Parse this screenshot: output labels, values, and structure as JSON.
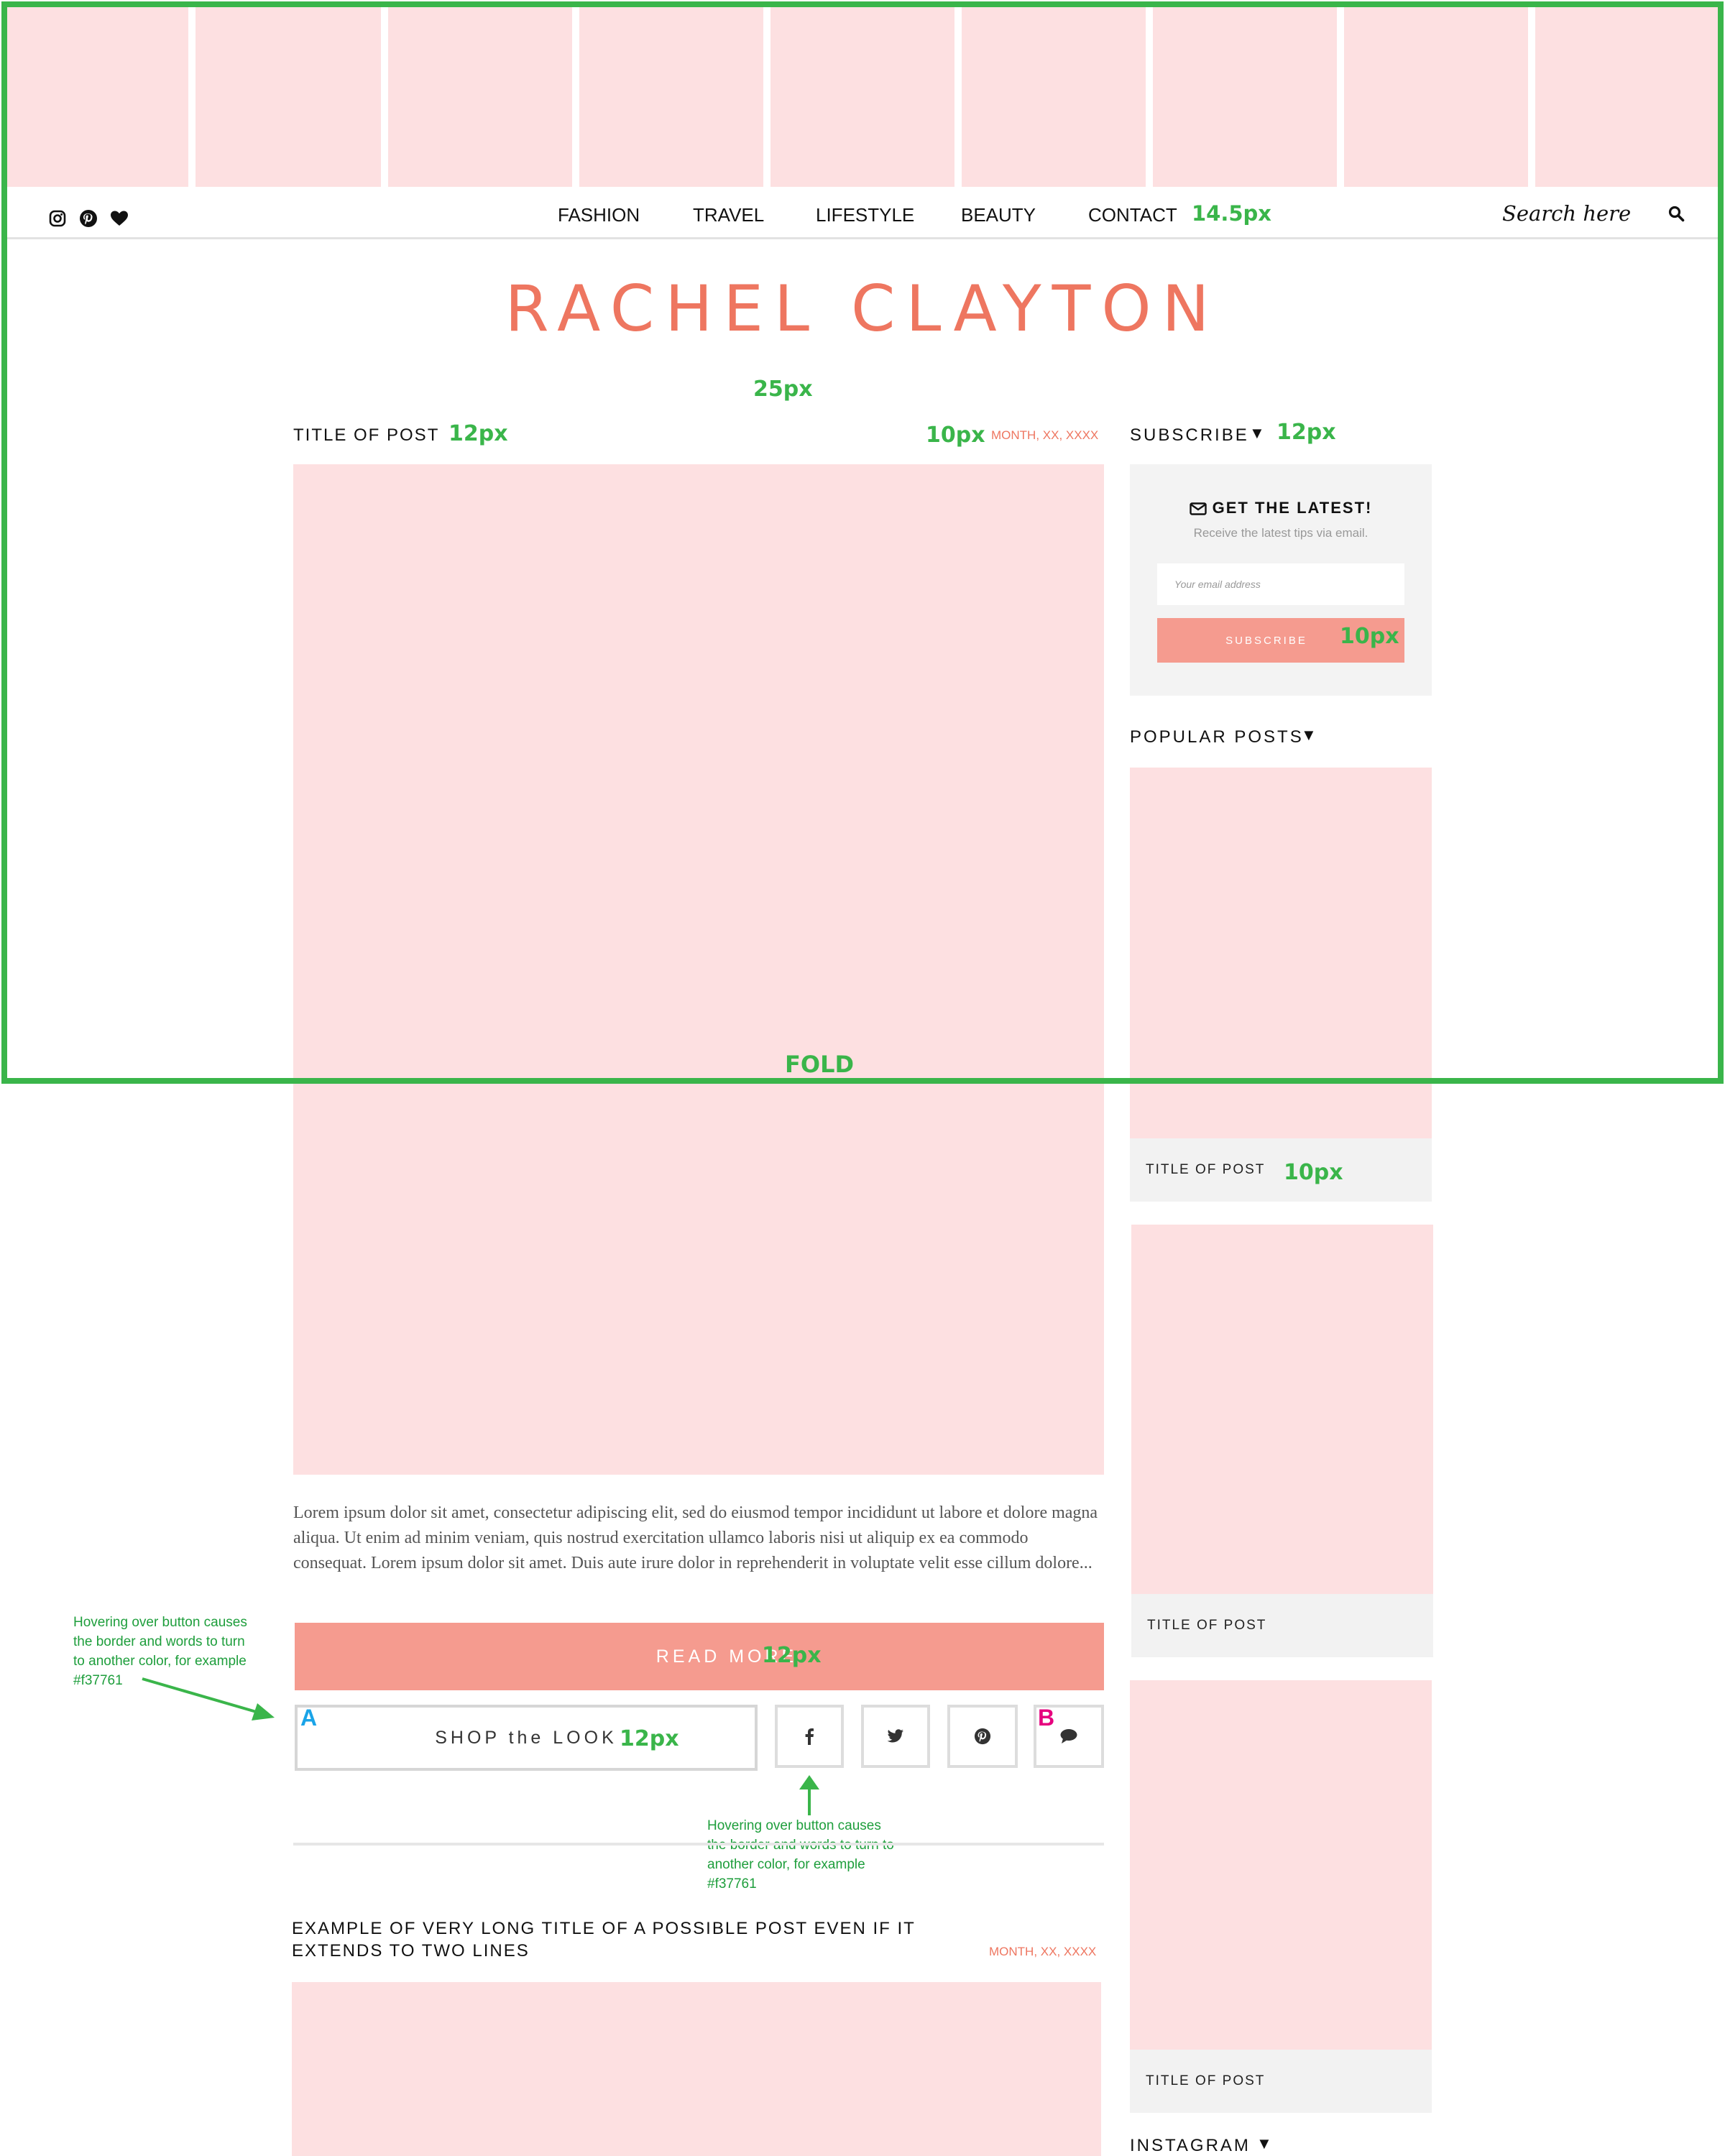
{
  "nav": {
    "items": [
      "FASHION",
      "TRAVEL",
      "LIFESTYLE",
      "BEAUTY",
      "CONTACT"
    ],
    "search_placeholder": "Search here",
    "social_icons": [
      "instagram-icon",
      "pinterest-icon",
      "heart-icon"
    ]
  },
  "site": {
    "title": "RACHEL CLAYTON",
    "accent_color": "#ee7660",
    "tile_color": "#fde0e1",
    "annotation_color": "#3ab54a"
  },
  "post1": {
    "title": "TITLE OF POST",
    "date": "MONTH, XX, XXXX",
    "excerpt": "Lorem ipsum dolor sit amet, consectetur adipiscing elit, sed do eiusmod tempor incididunt ut labore et dolore magna aliqua. Ut enim ad minim veniam, quis nostrud exercitation ullamco laboris nisi ut aliquip ex ea commodo consequat. Lorem ipsum dolor sit amet. Duis aute irure dolor in reprehenderit in voluptate velit esse cillum dolore...",
    "read_more": "READ MORE",
    "shop_label": "SHOP the LOOK"
  },
  "post2": {
    "title_line1": "EXAMPLE OF VERY LONG TITLE OF A POSSIBLE POST EVEN IF IT",
    "title_line2": "EXTENDS TO TWO LINES",
    "date": "MONTH, XX, XXXX"
  },
  "sidebar": {
    "subscribe_heading": "SUBSCRIBE",
    "subscribe_box": {
      "title": "GET THE LATEST!",
      "subtitle": "Receive the latest tips via email.",
      "email_placeholder": "Your email address",
      "button": "SUBSCRIBE"
    },
    "popular_heading": "POPULAR POSTS",
    "popular_posts": [
      "TITLE OF POST",
      "TITLE OF POST",
      "TITLE OF POST"
    ],
    "instagram_heading": "INSTAGRAM"
  },
  "annotations": {
    "nav_size": "14.5px",
    "title_gap": "25px",
    "post_title_size": "12px",
    "date_size": "10px",
    "subscribe_size": "12px",
    "subscribe_btn_size": "10px",
    "popular_caption_size": "10px",
    "fold": "FOLD",
    "read_more_size": "12px",
    "shop_size": "12px",
    "label_a": "A",
    "label_b": "B",
    "hover_note_left": [
      "Hovering over button causes",
      "the border and words to turn",
      "to another color, for example",
      "#f37761"
    ],
    "hover_note_center": [
      "Hovering over button causes",
      "the border and words to turn to",
      "another color, for example",
      "#f37761"
    ]
  }
}
